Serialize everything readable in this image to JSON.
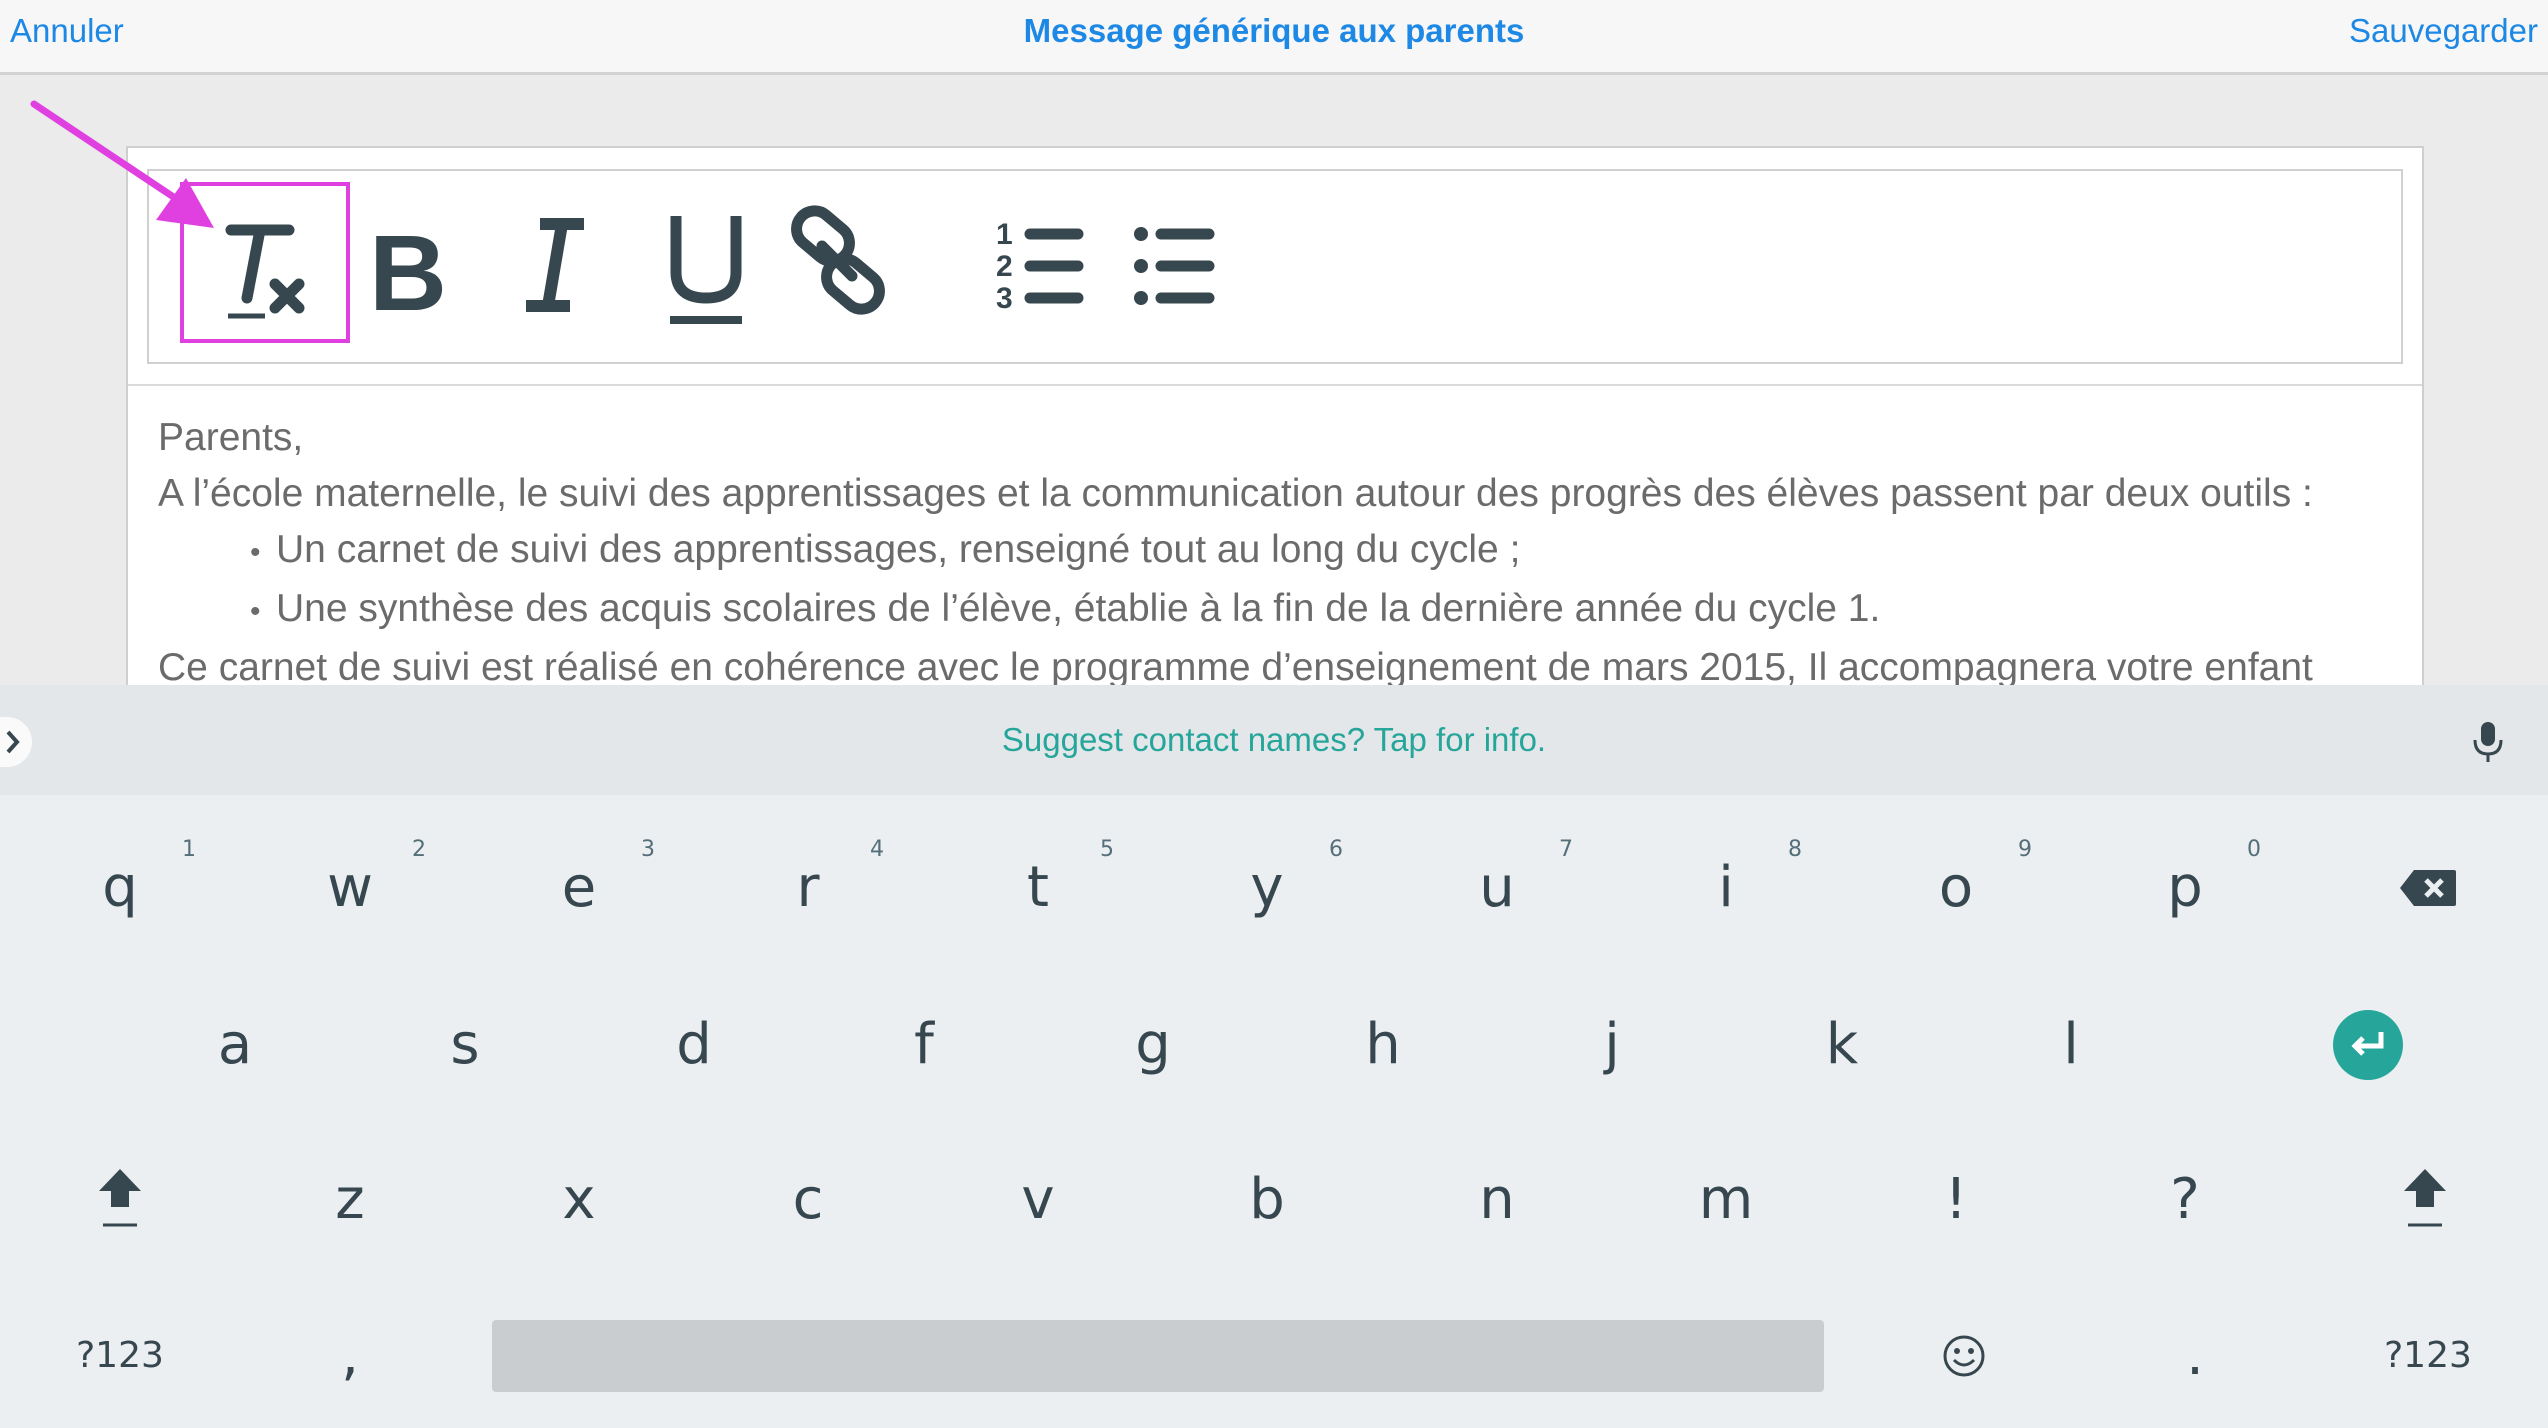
{
  "header": {
    "cancel_label": "Annuler",
    "title": "Message générique aux parents",
    "save_label": "Sauvegarder"
  },
  "toolbar": {
    "tools": [
      "clear-formatting",
      "bold",
      "italic",
      "underline",
      "link",
      "numbered-list",
      "bulleted-list"
    ],
    "highlighted_tool": "clear-formatting",
    "highlight_color": "#e040e0"
  },
  "editor": {
    "lines": [
      "Parents,",
      "A l’école maternelle, le suivi des apprentissages et la communication autour des progrès des élèves passent par deux outils :"
    ],
    "bullets": [
      "Un carnet de suivi des apprentissages, renseigné tout au long du cycle ;",
      "Une synthèse des acquis scolaires de l’élève, établie à la fin de la dernière année du cycle 1."
    ],
    "last_line": "Ce carnet de suivi est réalisé en cohérence avec le programme d’enseignement de mars 2015, Il accompagnera votre enfant"
  },
  "keyboard": {
    "suggestion": "Suggest contact names? Tap for info.",
    "row1": [
      "q",
      "w",
      "e",
      "r",
      "t",
      "y",
      "u",
      "i",
      "o",
      "p"
    ],
    "row1_numbers": [
      "1",
      "2",
      "3",
      "4",
      "5",
      "6",
      "7",
      "8",
      "9",
      "0"
    ],
    "row2": [
      "a",
      "s",
      "d",
      "f",
      "g",
      "h",
      "j",
      "k",
      "l"
    ],
    "row3": [
      "z",
      "x",
      "c",
      "v",
      "b",
      "n",
      "m",
      "!",
      "?"
    ],
    "row4": {
      "symbols_left": "?123",
      "comma": ",",
      "period": ".",
      "symbols_right": "?123"
    },
    "accent_color": "#26a69a"
  }
}
